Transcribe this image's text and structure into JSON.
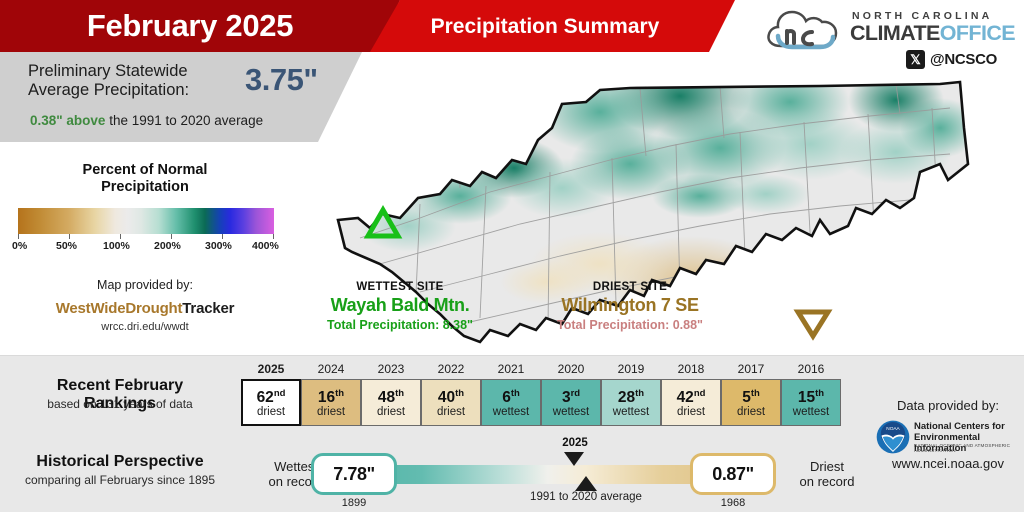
{
  "header": {
    "month_title": "February 2025",
    "subtitle": "Precipitation Summary",
    "logo": {
      "line_top": "NORTH CAROLINA",
      "climate": "CLIMATE",
      "office": "OFFICE",
      "x_glyph": "𝕏",
      "handle": "@NCSCO"
    }
  },
  "stat_panel": {
    "label_line1": "Preliminary Statewide",
    "label_line2": "Average Precipitation:",
    "value": "3.75\"",
    "departure_value": "0.38\" above",
    "departure_rest": " the 1991 to 2020 average"
  },
  "legend": {
    "title_line1": "Percent of Normal",
    "title_line2": "Precipitation",
    "ticks": [
      "0%",
      "50%",
      "100%",
      "200%",
      "300%",
      "400%"
    ],
    "map_provided_by": "Map provided by:",
    "provider_a": "WestWideDrought",
    "provider_b": "Tracker",
    "provider_url": "wrcc.dri.edu/wwdt"
  },
  "sites": {
    "wettest": {
      "heading": "WETTEST SITE",
      "name": "Wayah Bald Mtn.",
      "total": "Total Precipitation: 8.38\"",
      "color": "#18a018",
      "marker": "triangle-up-icon"
    },
    "driest": {
      "heading": "DRIEST SITE",
      "name": "Wilmington 7 SE",
      "total": "Total Precipitation: 0.88\"",
      "color": "#9a7424",
      "marker": "triangle-down-icon"
    }
  },
  "rankings": {
    "title": "Recent February Rankings",
    "subtitle": "based on 131 years of data",
    "cells": [
      {
        "year": "2025",
        "rank": "62",
        "sup": "nd",
        "label": "driest",
        "color": "#ffffff",
        "current": true
      },
      {
        "year": "2024",
        "rank": "16",
        "sup": "th",
        "label": "driest",
        "color": "#ddbd80",
        "current": false
      },
      {
        "year": "2023",
        "rank": "48",
        "sup": "th",
        "label": "driest",
        "color": "#f5ecd8",
        "current": false
      },
      {
        "year": "2022",
        "rank": "40",
        "sup": "th",
        "label": "driest",
        "color": "#eddfbd",
        "current": false
      },
      {
        "year": "2021",
        "rank": "6",
        "sup": "th",
        "label": "wettest",
        "color": "#5cb7ab",
        "current": false
      },
      {
        "year": "2020",
        "rank": "3",
        "sup": "rd",
        "label": "wettest",
        "color": "#5cb7ab",
        "current": false
      },
      {
        "year": "2019",
        "rank": "28",
        "sup": "th",
        "label": "wettest",
        "color": "#a5d6cd",
        "current": false
      },
      {
        "year": "2018",
        "rank": "42",
        "sup": "nd",
        "label": "driest",
        "color": "#f5ecd8",
        "current": false
      },
      {
        "year": "2017",
        "rank": "5",
        "sup": "th",
        "label": "driest",
        "color": "#ddb96a",
        "current": false
      },
      {
        "year": "2016",
        "rank": "15",
        "sup": "th",
        "label": "wettest",
        "color": "#5cb7ab",
        "current": false
      }
    ]
  },
  "historical": {
    "title": "Historical Perspective",
    "subtitle": "comparing all Februarys since 1895",
    "wettest_label_1": "Wettest",
    "wettest_label_2": "on record",
    "wettest_value": "7.78\"",
    "wettest_year": "1899",
    "driest_label_1": "Driest",
    "driest_label_2": "on record",
    "driest_value": "0.87\"",
    "driest_year": "1968",
    "current_marker_label": "2025",
    "average_marker_label": "1991 to 2020 average"
  },
  "noaa": {
    "provided_by": "Data provided by:",
    "name_line1": "National Centers for",
    "name_line2": "Environmental Information",
    "name_line3": "NATIONAL OCEANIC AND ATMOSPHERIC ADMINISTRATION",
    "url": "www.ncei.noaa.gov"
  },
  "colors": {
    "dark_red": "#a00508",
    "red": "#d50a0a",
    "panel_gray": "#cfcfcf",
    "bottom_gray": "#e8e8e8",
    "stat_blue": "#3a5576",
    "green": "#3f8a3f",
    "teal": "#4fb3a6",
    "tan": "#ddb96a"
  }
}
